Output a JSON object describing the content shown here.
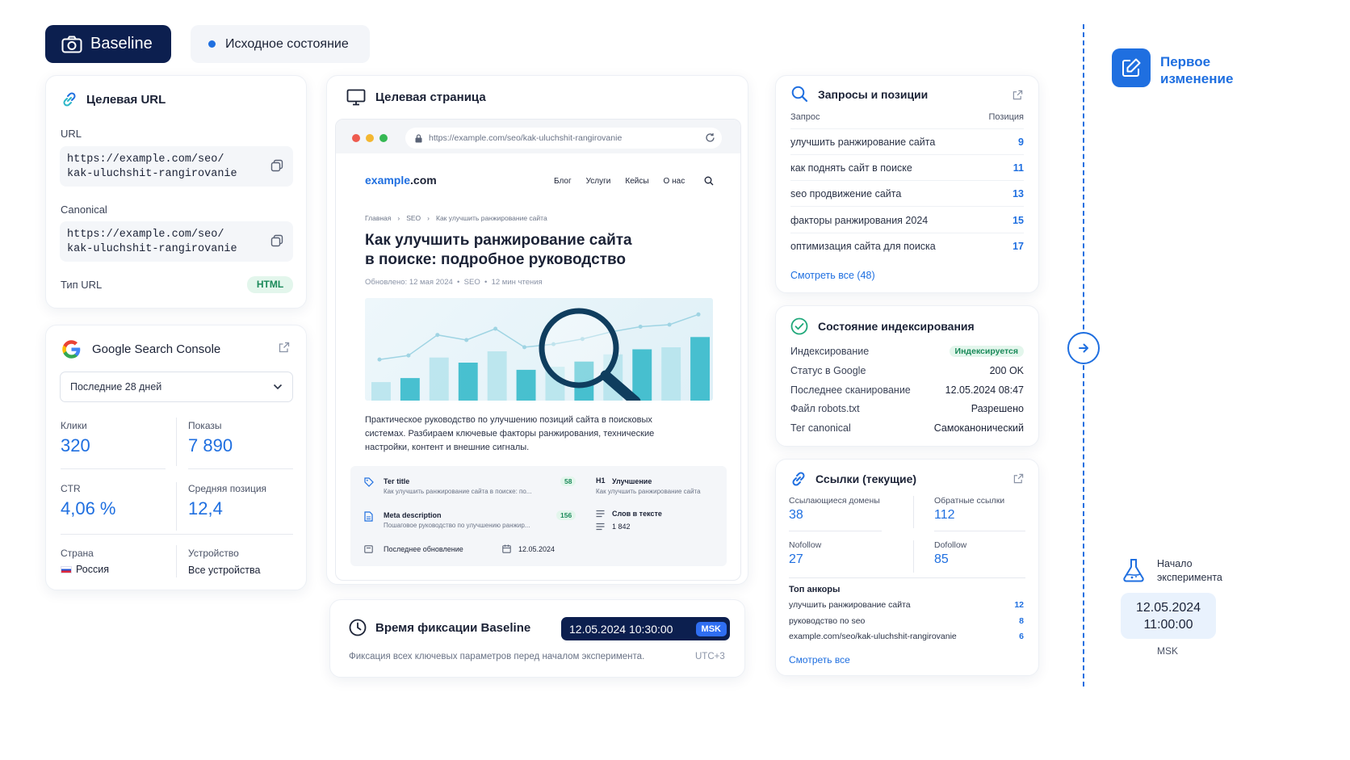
{
  "header": {
    "baseline_label": "Baseline",
    "state_label": "Исходное состояние"
  },
  "target_url": {
    "title": "Целевая URL",
    "url_label": "URL",
    "url_line1": "https://example.com/seo/",
    "url_line2": "kak-uluchshit-rangirovanie",
    "canonical_label": "Canonical",
    "canonical_line1": "https://example.com/seo/",
    "canonical_line2": "kak-uluchshit-rangirovanie",
    "type_label": "Тип URL",
    "type_value": "HTML"
  },
  "gsc": {
    "title": "Google Search Console",
    "period": "Последние 28 дней",
    "clicks_label": "Клики",
    "clicks_value": "320",
    "impressions_label": "Показы",
    "impressions_value": "7 890",
    "ctr_label": "CTR",
    "ctr_value": "4,06 %",
    "avgpos_label": "Средняя позиция",
    "avgpos_value": "12,4",
    "country_label": "Страна",
    "country_value": "Россия",
    "device_label": "Устройство",
    "device_value": "Все устройства"
  },
  "target_page": {
    "title": "Целевая страница",
    "address": "https://example.com/seo/kak-uluchshit-rangirovanie",
    "logo_a": "example",
    "logo_b": ".com",
    "nav": [
      "Блог",
      "Услуги",
      "Кейсы",
      "О нас"
    ],
    "breadcrumb": [
      "Главная",
      "SEO",
      "Как улучшить ранжирование сайта"
    ],
    "heading_line1": "Как улучшить ранжирование сайта",
    "heading_line2": "в поиске: подробное руководство",
    "meta_line": "Обновлено: 12 мая 2024  •  SEO  •  12 мин чтения",
    "paragraph_1": "Практическое руководство по улучшению позиций сайта в поисковых",
    "paragraph_2": "системах. Разбираем ключевые факторы ранжирования, технические",
    "paragraph_3": "настройки, контент и внешние сигналы.",
    "tag_title_label": "Тег title",
    "tag_title_value": "Как улучшить ранжирование сайта в поиске: по...",
    "tag_title_count": "58",
    "meta_desc_label": "Meta description",
    "meta_desc_value": "Пошаговое руководство по улучшению ранжир...",
    "meta_desc_count": "156",
    "h1_tag": "H1",
    "h1_label": "Улучшение",
    "h1_value": "Как улучшить ранжирование сайта",
    "words_label": "Слов в тексте",
    "words_value": "1 842",
    "last_update_label": "Последнее обновление",
    "last_update_value": "12.05.2024",
    "chart": {
      "bars": [
        0.18,
        0.22,
        0.42,
        0.37,
        0.48,
        0.3,
        0.33,
        0.38,
        0.45,
        0.5,
        0.52,
        0.62
      ]
    }
  },
  "fix_time": {
    "title": "Время фиксации Baseline",
    "datetime": "12.05.2024 10:30:00",
    "tz": "MSK",
    "note": "Фиксация всех ключевых параметров перед началом эксперимента.",
    "utc": "UTC+3"
  },
  "queries": {
    "title": "Запросы и позиции",
    "col_query": "Запрос",
    "col_pos": "Позиция",
    "rows": [
      {
        "q": "улучшить ранжирование сайта",
        "p": "9"
      },
      {
        "q": "как поднять сайт в поиске",
        "p": "11"
      },
      {
        "q": "seo продвижение сайта",
        "p": "13"
      },
      {
        "q": "факторы ранжирования 2024",
        "p": "15"
      },
      {
        "q": "оптимизация сайта для поиска",
        "p": "17"
      }
    ],
    "see_all": "Смотреть все (48)"
  },
  "indexing": {
    "title": "Состояние индексирования",
    "rows": [
      {
        "k": "Индексирование",
        "v": "Индексируется"
      },
      {
        "k": "Статус в Google",
        "v": "200 OK"
      },
      {
        "k": "Последнее сканирование",
        "v": "12.05.2024 08:47"
      },
      {
        "k": "Файл robots.txt",
        "v": "Разрешено"
      },
      {
        "k": "Тег canonical",
        "v": "Самоканонический"
      }
    ]
  },
  "links": {
    "title": "Ссылки (текущие)",
    "ref_domains_label": "Ссылающиеся домены",
    "ref_domains_value": "38",
    "backlinks_label": "Обратные ссылки",
    "backlinks_value": "112",
    "nofollow_label": "Nofollow",
    "nofollow_value": "27",
    "dofollow_label": "Dofollow",
    "dofollow_value": "85",
    "anchors_title": "Топ анкоры",
    "anchors": [
      {
        "a": "улучшить ранжирование сайта",
        "n": "12"
      },
      {
        "a": "руководство по seo",
        "n": "8"
      },
      {
        "a": "example.com/seo/kak-uluchshit-rangirovanie",
        "n": "6"
      }
    ],
    "see_all": "Смотреть все"
  },
  "timeline": {
    "first_change_line1": "Первое",
    "first_change_line2": "изменение",
    "start_line1": "Начало",
    "start_line2": "эксперимента",
    "start_date": "12.05.2024",
    "start_time": "11:00:00",
    "start_tz": "MSK"
  },
  "colors": {
    "accent": "#1f6fe0",
    "navy": "#0c1f4f",
    "teal": "#2bb6c8",
    "green_badge": "#e3f6ec"
  }
}
